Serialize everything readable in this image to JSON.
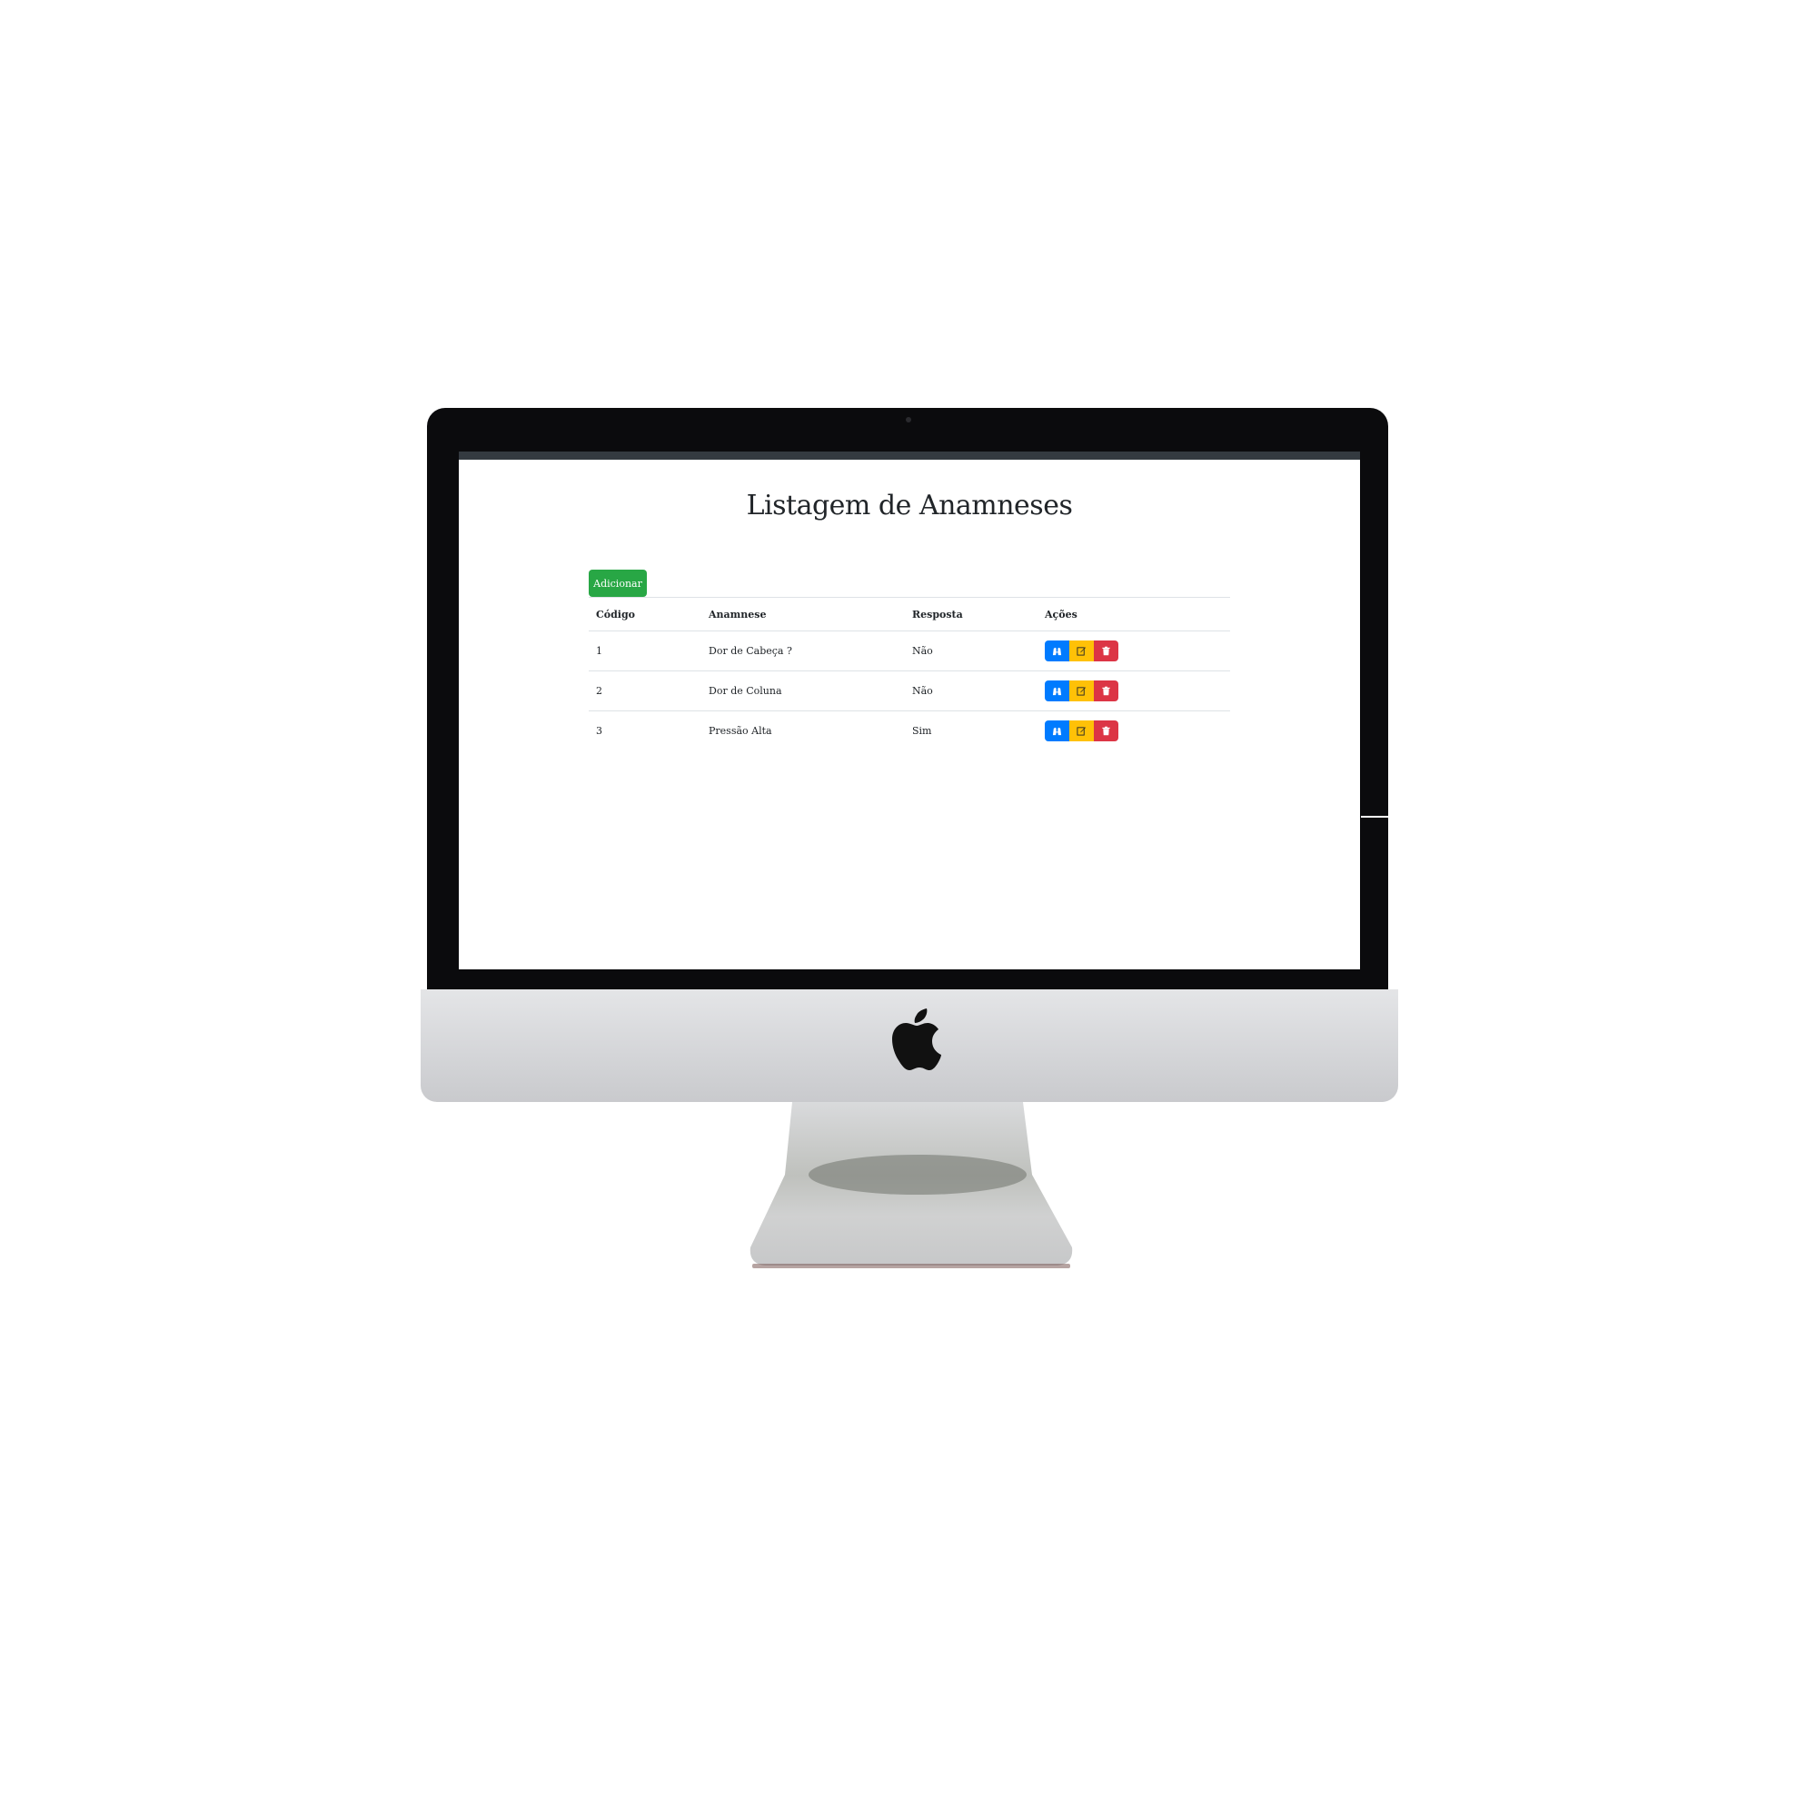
{
  "page": {
    "title": "Listagem de Anamneses",
    "add_button": "Adicionar"
  },
  "table": {
    "headers": [
      "Código",
      "Anamnese",
      "Resposta",
      "Ações"
    ],
    "rows": [
      {
        "codigo": "1",
        "anamnese": "Dor de Cabeça ?",
        "resposta": "Não"
      },
      {
        "codigo": "2",
        "anamnese": "Dor de Coluna",
        "resposta": "Não"
      },
      {
        "codigo": "3",
        "anamnese": "Pressão Alta",
        "resposta": "Sim"
      }
    ]
  },
  "actions": {
    "view_icon": "binoculars-icon",
    "edit_icon": "edit-icon",
    "delete_icon": "trash-icon"
  },
  "colors": {
    "add": "#28a745",
    "view": "#007bff",
    "edit": "#ffc107",
    "delete": "#dc3545",
    "topbar": "#343a40"
  }
}
